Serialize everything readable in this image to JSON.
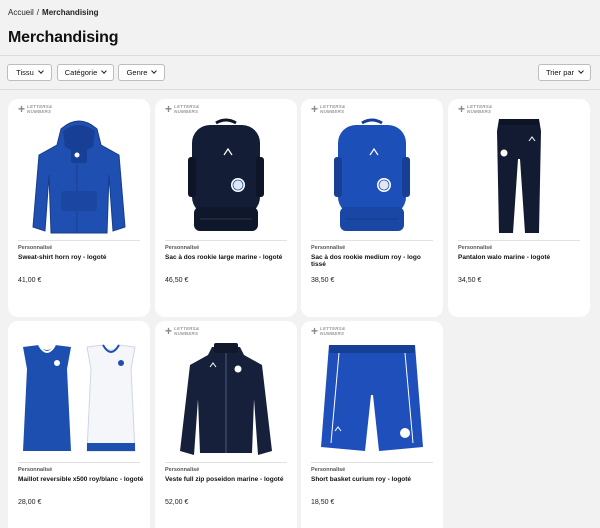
{
  "breadcrumb": {
    "home": "Accueil",
    "separator": "/",
    "current": "Merchandising"
  },
  "page": {
    "title": "Merchandising"
  },
  "filters": [
    {
      "label": "Tissu"
    },
    {
      "label": "Catégorie"
    },
    {
      "label": "Genre"
    }
  ],
  "sort": {
    "label": "Trier par"
  },
  "badge": {
    "line1": "LETTERS&",
    "line2": "NUMBERS"
  },
  "products": [
    {
      "kind": "Personnalisé",
      "name": "Sweat-shirt horn roy - logoté",
      "price": "41,00 €",
      "icon": "hoodie-icon",
      "color": "#1f4fb0"
    },
    {
      "kind": "Personnalisé",
      "name": "Sac à dos rookie large marine - logoté",
      "price": "46,50 €",
      "icon": "backpack-icon",
      "color": "#131d35"
    },
    {
      "kind": "Personnalisé",
      "name": "Sac à dos rookie medium roy - logo tissé",
      "price": "38,50 €",
      "icon": "backpack-icon",
      "color": "#1d4fb8"
    },
    {
      "kind": "Personnalisé",
      "name": "Pantalon walo marine - logoté",
      "price": "34,50 €",
      "icon": "pants-icon",
      "color": "#131b33"
    },
    {
      "kind": "Personnalisé",
      "name": "Maillot reversible x500 roy/blanc - logoté",
      "price": "28,00 €",
      "icon": "jersey-icon",
      "color": "#1d4fb0"
    },
    {
      "kind": "Personnalisé",
      "name": "Veste full zip poseidon marine - logoté",
      "price": "52,00 €",
      "icon": "jacket-icon",
      "color": "#16203a"
    },
    {
      "kind": "Personnalisé",
      "name": "Short basket curium roy - logoté",
      "price": "18,50 €",
      "icon": "shorts-icon",
      "color": "#1e4fbb"
    }
  ]
}
